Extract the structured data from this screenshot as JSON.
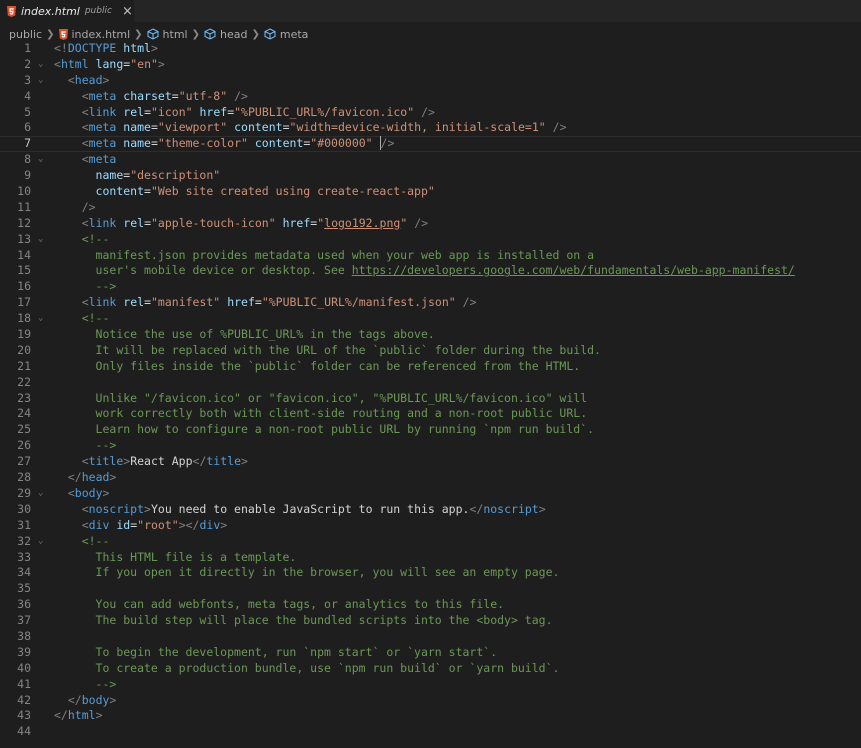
{
  "tab": {
    "name": "index.html",
    "desc": "public",
    "close": "×"
  },
  "breadcrumb": [
    "public",
    "index.html",
    "html",
    "head",
    "meta"
  ],
  "colors": {
    "tag": "#569cd6",
    "bracket": "#808080",
    "attr": "#9cdcfe",
    "value": "#ce9178",
    "comment": "#6a9955",
    "text": "#d4d4d4",
    "html5": "#e44d26"
  },
  "editor": {
    "lines": [
      {
        "n": "1",
        "fold": "",
        "ind": 0,
        "t": [
          [
            "br",
            "<!"
          ],
          [
            "tag",
            "DOCTYPE"
          ],
          [
            "txt",
            " "
          ],
          [
            "attr",
            "html"
          ],
          [
            "br",
            ">"
          ]
        ]
      },
      {
        "n": "2",
        "fold": "⌄",
        "ind": 0,
        "t": [
          [
            "br",
            "<"
          ],
          [
            "tag",
            "html"
          ],
          [
            "txt",
            " "
          ],
          [
            "attr",
            "lang"
          ],
          [
            "txt",
            "="
          ],
          [
            "val",
            "\"en\""
          ],
          [
            "br",
            ">"
          ]
        ]
      },
      {
        "n": "3",
        "fold": "⌄",
        "ind": 1,
        "t": [
          [
            "br",
            "<"
          ],
          [
            "tag",
            "head"
          ],
          [
            "br",
            ">"
          ]
        ]
      },
      {
        "n": "4",
        "fold": "",
        "ind": 2,
        "t": [
          [
            "br",
            "<"
          ],
          [
            "tag",
            "meta"
          ],
          [
            "txt",
            " "
          ],
          [
            "attr",
            "charset"
          ],
          [
            "txt",
            "="
          ],
          [
            "val",
            "\"utf-8\""
          ],
          [
            "txt",
            " "
          ],
          [
            "br",
            "/>"
          ]
        ]
      },
      {
        "n": "5",
        "fold": "",
        "ind": 2,
        "t": [
          [
            "br",
            "<"
          ],
          [
            "tag",
            "link"
          ],
          [
            "txt",
            " "
          ],
          [
            "attr",
            "rel"
          ],
          [
            "txt",
            "="
          ],
          [
            "val",
            "\"icon\""
          ],
          [
            "txt",
            " "
          ],
          [
            "attr",
            "href"
          ],
          [
            "txt",
            "="
          ],
          [
            "val",
            "\"%PUBLIC_URL%/favicon.ico\""
          ],
          [
            "txt",
            " "
          ],
          [
            "br",
            "/>"
          ]
        ]
      },
      {
        "n": "6",
        "fold": "",
        "ind": 2,
        "t": [
          [
            "br",
            "<"
          ],
          [
            "tag",
            "meta"
          ],
          [
            "txt",
            " "
          ],
          [
            "attr",
            "name"
          ],
          [
            "txt",
            "="
          ],
          [
            "val",
            "\"viewport\""
          ],
          [
            "txt",
            " "
          ],
          [
            "attr",
            "content"
          ],
          [
            "txt",
            "="
          ],
          [
            "val",
            "\"width=device-width, initial-scale=1\""
          ],
          [
            "txt",
            " "
          ],
          [
            "br",
            "/>"
          ]
        ]
      },
      {
        "n": "7",
        "fold": "",
        "ind": 2,
        "active": true,
        "t": [
          [
            "br",
            "<"
          ],
          [
            "tag",
            "meta"
          ],
          [
            "txt",
            " "
          ],
          [
            "attr",
            "name"
          ],
          [
            "txt",
            "="
          ],
          [
            "val",
            "\"theme-color\""
          ],
          [
            "txt",
            " "
          ],
          [
            "attr",
            "content"
          ],
          [
            "txt",
            "="
          ],
          [
            "val",
            "\"#000000\""
          ],
          [
            "txt",
            " "
          ],
          [
            "br",
            "/>"
          ]
        ]
      },
      {
        "n": "8",
        "fold": "⌄",
        "ind": 2,
        "t": [
          [
            "br",
            "<"
          ],
          [
            "tag",
            "meta"
          ]
        ]
      },
      {
        "n": "9",
        "fold": "",
        "ind": 3,
        "t": [
          [
            "attr",
            "name"
          ],
          [
            "txt",
            "="
          ],
          [
            "val",
            "\"description\""
          ]
        ]
      },
      {
        "n": "10",
        "fold": "",
        "ind": 3,
        "t": [
          [
            "attr",
            "content"
          ],
          [
            "txt",
            "="
          ],
          [
            "val",
            "\"Web site created using create-react-app\""
          ]
        ]
      },
      {
        "n": "11",
        "fold": "",
        "ind": 2,
        "t": [
          [
            "br",
            "/>"
          ]
        ]
      },
      {
        "n": "12",
        "fold": "",
        "ind": 2,
        "t": [
          [
            "br",
            "<"
          ],
          [
            "tag",
            "link"
          ],
          [
            "txt",
            " "
          ],
          [
            "attr",
            "rel"
          ],
          [
            "txt",
            "="
          ],
          [
            "val",
            "\"apple-touch-icon\""
          ],
          [
            "txt",
            " "
          ],
          [
            "attr",
            "href"
          ],
          [
            "txt",
            "="
          ],
          [
            "val",
            "\""
          ],
          [
            "valu",
            "logo192.png"
          ],
          [
            "val",
            "\""
          ],
          [
            "txt",
            " "
          ],
          [
            "br",
            "/>"
          ]
        ]
      },
      {
        "n": "13",
        "fold": "⌄",
        "ind": 2,
        "t": [
          [
            "com",
            "<!--"
          ]
        ]
      },
      {
        "n": "14",
        "fold": "",
        "ind": 3,
        "t": [
          [
            "com",
            "manifest.json provides metadata used when your web app is installed on a"
          ]
        ]
      },
      {
        "n": "15",
        "fold": "",
        "ind": 3,
        "t": [
          [
            "com",
            "user's mobile device or desktop. See "
          ],
          [
            "comu",
            "https://developers.google.com/web/fundamentals/web-app-manifest/"
          ]
        ]
      },
      {
        "n": "16",
        "fold": "",
        "ind": 3,
        "t": [
          [
            "com",
            "-->"
          ]
        ]
      },
      {
        "n": "17",
        "fold": "",
        "ind": 2,
        "t": [
          [
            "br",
            "<"
          ],
          [
            "tag",
            "link"
          ],
          [
            "txt",
            " "
          ],
          [
            "attr",
            "rel"
          ],
          [
            "txt",
            "="
          ],
          [
            "val",
            "\"manifest\""
          ],
          [
            "txt",
            " "
          ],
          [
            "attr",
            "href"
          ],
          [
            "txt",
            "="
          ],
          [
            "val",
            "\"%PUBLIC_URL%/manifest.json\""
          ],
          [
            "txt",
            " "
          ],
          [
            "br",
            "/>"
          ]
        ]
      },
      {
        "n": "18",
        "fold": "⌄",
        "ind": 2,
        "t": [
          [
            "com",
            "<!--"
          ]
        ]
      },
      {
        "n": "19",
        "fold": "",
        "ind": 3,
        "t": [
          [
            "com",
            "Notice the use of %PUBLIC_URL% in the tags above."
          ]
        ]
      },
      {
        "n": "20",
        "fold": "",
        "ind": 3,
        "t": [
          [
            "com",
            "It will be replaced with the URL of the `public` folder during the build."
          ]
        ]
      },
      {
        "n": "21",
        "fold": "",
        "ind": 3,
        "t": [
          [
            "com",
            "Only files inside the `public` folder can be referenced from the HTML."
          ]
        ]
      },
      {
        "n": "22",
        "fold": "",
        "ind": 0,
        "t": []
      },
      {
        "n": "23",
        "fold": "",
        "ind": 3,
        "t": [
          [
            "com",
            "Unlike \"/favicon.ico\" or \"favicon.ico\", \"%PUBLIC_URL%/favicon.ico\" will"
          ]
        ]
      },
      {
        "n": "24",
        "fold": "",
        "ind": 3,
        "t": [
          [
            "com",
            "work correctly both with client-side routing and a non-root public URL."
          ]
        ]
      },
      {
        "n": "25",
        "fold": "",
        "ind": 3,
        "t": [
          [
            "com",
            "Learn how to configure a non-root public URL by running `npm run build`."
          ]
        ]
      },
      {
        "n": "26",
        "fold": "",
        "ind": 3,
        "t": [
          [
            "com",
            "-->"
          ]
        ]
      },
      {
        "n": "27",
        "fold": "",
        "ind": 2,
        "t": [
          [
            "br",
            "<"
          ],
          [
            "tag",
            "title"
          ],
          [
            "br",
            ">"
          ],
          [
            "txt",
            "React App"
          ],
          [
            "br",
            "</"
          ],
          [
            "tag",
            "title"
          ],
          [
            "br",
            ">"
          ]
        ]
      },
      {
        "n": "28",
        "fold": "",
        "ind": 1,
        "t": [
          [
            "br",
            "</"
          ],
          [
            "tag",
            "head"
          ],
          [
            "br",
            ">"
          ]
        ]
      },
      {
        "n": "29",
        "fold": "⌄",
        "ind": 1,
        "t": [
          [
            "br",
            "<"
          ],
          [
            "tag",
            "body"
          ],
          [
            "br",
            ">"
          ]
        ]
      },
      {
        "n": "30",
        "fold": "",
        "ind": 2,
        "t": [
          [
            "br",
            "<"
          ],
          [
            "tag",
            "noscript"
          ],
          [
            "br",
            ">"
          ],
          [
            "txt",
            "You need to enable JavaScript to run this app."
          ],
          [
            "br",
            "</"
          ],
          [
            "tag",
            "noscript"
          ],
          [
            "br",
            ">"
          ]
        ]
      },
      {
        "n": "31",
        "fold": "",
        "ind": 2,
        "t": [
          [
            "br",
            "<"
          ],
          [
            "tag",
            "div"
          ],
          [
            "txt",
            " "
          ],
          [
            "attr",
            "id"
          ],
          [
            "txt",
            "="
          ],
          [
            "val",
            "\"root\""
          ],
          [
            "br",
            "></"
          ],
          [
            "tag",
            "div"
          ],
          [
            "br",
            ">"
          ]
        ]
      },
      {
        "n": "32",
        "fold": "⌄",
        "ind": 2,
        "t": [
          [
            "com",
            "<!--"
          ]
        ]
      },
      {
        "n": "33",
        "fold": "",
        "ind": 3,
        "t": [
          [
            "com",
            "This HTML file is a template."
          ]
        ]
      },
      {
        "n": "34",
        "fold": "",
        "ind": 3,
        "t": [
          [
            "com",
            "If you open it directly in the browser, you will see an empty page."
          ]
        ]
      },
      {
        "n": "35",
        "fold": "",
        "ind": 0,
        "t": []
      },
      {
        "n": "36",
        "fold": "",
        "ind": 3,
        "t": [
          [
            "com",
            "You can add webfonts, meta tags, or analytics to this file."
          ]
        ]
      },
      {
        "n": "37",
        "fold": "",
        "ind": 3,
        "t": [
          [
            "com",
            "The build step will place the bundled scripts into the <body> tag."
          ]
        ]
      },
      {
        "n": "38",
        "fold": "",
        "ind": 0,
        "t": []
      },
      {
        "n": "39",
        "fold": "",
        "ind": 3,
        "t": [
          [
            "com",
            "To begin the development, run `npm start` or `yarn start`."
          ]
        ]
      },
      {
        "n": "40",
        "fold": "",
        "ind": 3,
        "t": [
          [
            "com",
            "To create a production bundle, use `npm run build` or `yarn build`."
          ]
        ]
      },
      {
        "n": "41",
        "fold": "",
        "ind": 3,
        "t": [
          [
            "com",
            "-->"
          ]
        ]
      },
      {
        "n": "42",
        "fold": "",
        "ind": 1,
        "t": [
          [
            "br",
            "</"
          ],
          [
            "tag",
            "body"
          ],
          [
            "br",
            ">"
          ]
        ]
      },
      {
        "n": "43",
        "fold": "",
        "ind": 0,
        "t": [
          [
            "br",
            "</"
          ],
          [
            "tag",
            "html"
          ],
          [
            "br",
            ">"
          ]
        ]
      },
      {
        "n": "44",
        "fold": "",
        "ind": 0,
        "t": []
      }
    ]
  }
}
